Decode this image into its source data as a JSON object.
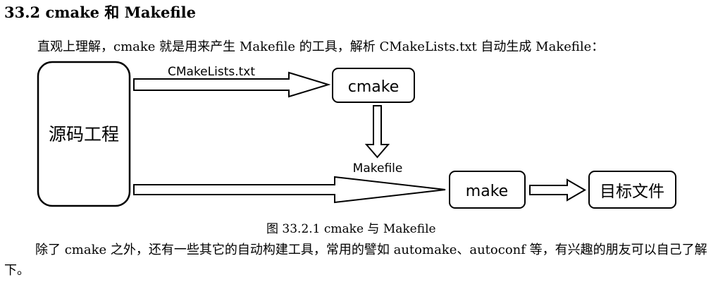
{
  "section": {
    "heading": "33.2 cmake 和 Makefile",
    "intro": "直观上理解，cmake 就是用来产生 Makefile 的工具，解析 CMakeLists.txt 自动生成 Makefile："
  },
  "diagram": {
    "source_label": "源码工程",
    "cmake_label": "cmake",
    "make_label": "make",
    "target_label": "目标文件",
    "arrow_cmakelists_label": "CMakeLists.txt",
    "arrow_makefile_label": "Makefile"
  },
  "figure": {
    "caption": "图  33.2.1 cmake 与 Makefile"
  },
  "body": {
    "paragraph": "除了 cmake 之外，还有一些其它的自动构建工具，常用的譬如 automake、autoconf 等，有兴趣的朋友可以自己了解下。"
  }
}
